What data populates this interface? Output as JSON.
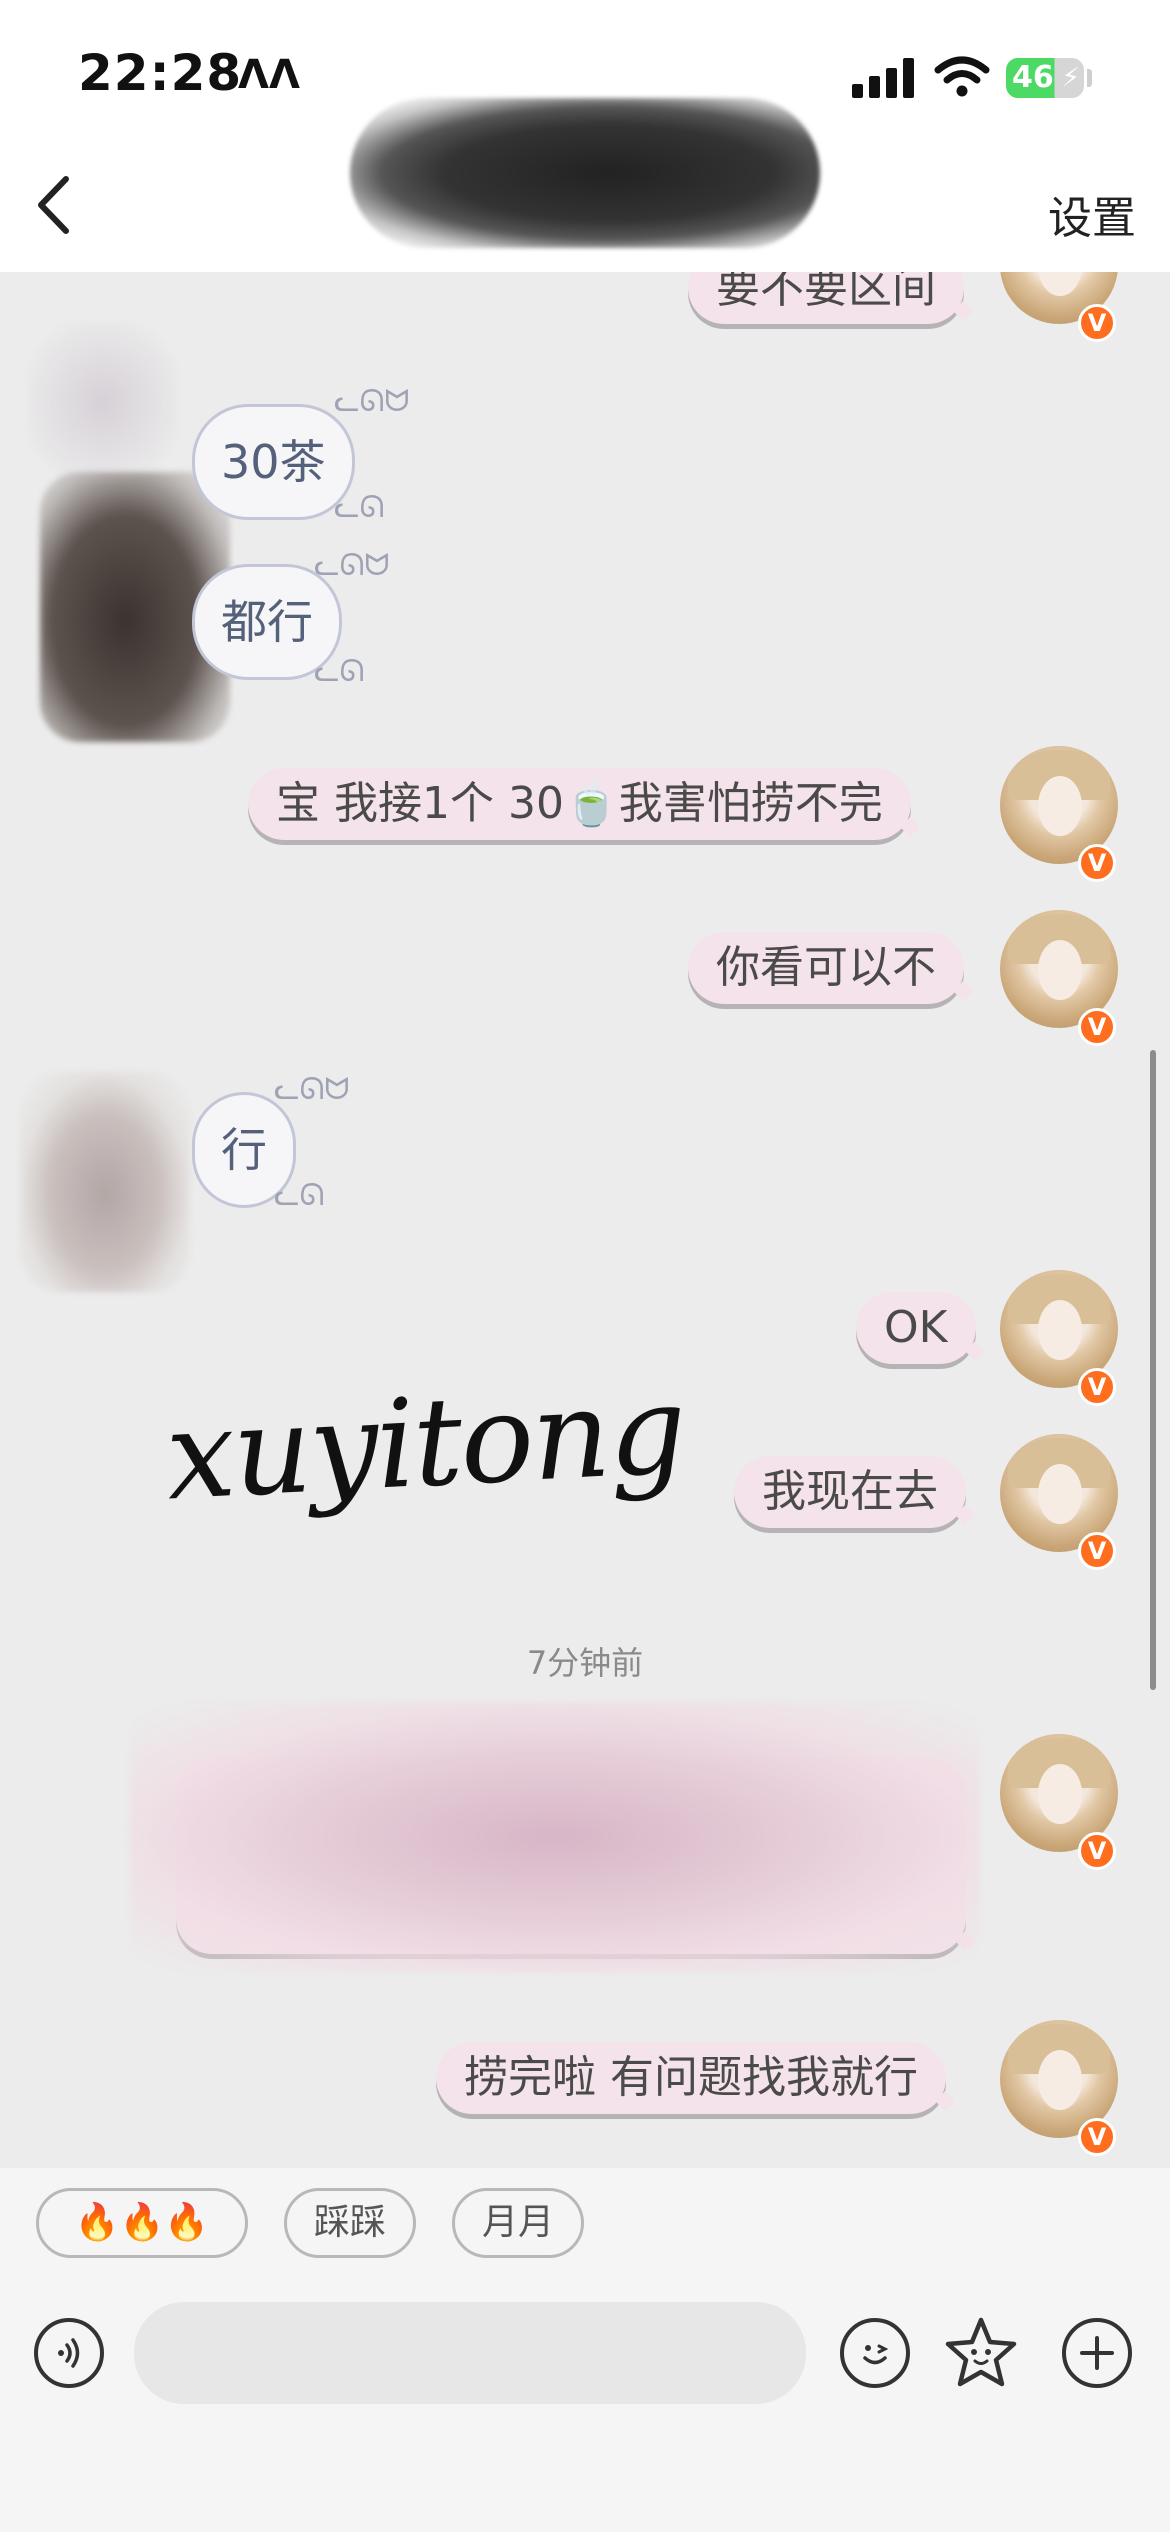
{
  "status_bar": {
    "time": "22:28",
    "time_glyph": "ꓥꓥ",
    "battery": "46"
  },
  "nav": {
    "settings_label": "设置"
  },
  "messages": {
    "m0": "要不要区间",
    "m1": "30茶",
    "m2": "都行",
    "m3": "宝 我接1个  30🍵我害怕捞不完",
    "m4": "你看可以不",
    "m5": "行",
    "m6": "OK",
    "m7": "我现在去",
    "m8": "",
    "m9": "捞完啦 有问题找我就行"
  },
  "badge_label": "V",
  "timestamp": "7分钟前",
  "watermark": "xuyitong",
  "quick_replies": [
    "🔥🔥🔥",
    "踩踩",
    "月月"
  ],
  "input": {
    "placeholder": ""
  },
  "colors": {
    "outgoing_bubble": "#f4e3ea",
    "incoming_border": "#c3c6d7",
    "badge": "#ff6d1f"
  }
}
